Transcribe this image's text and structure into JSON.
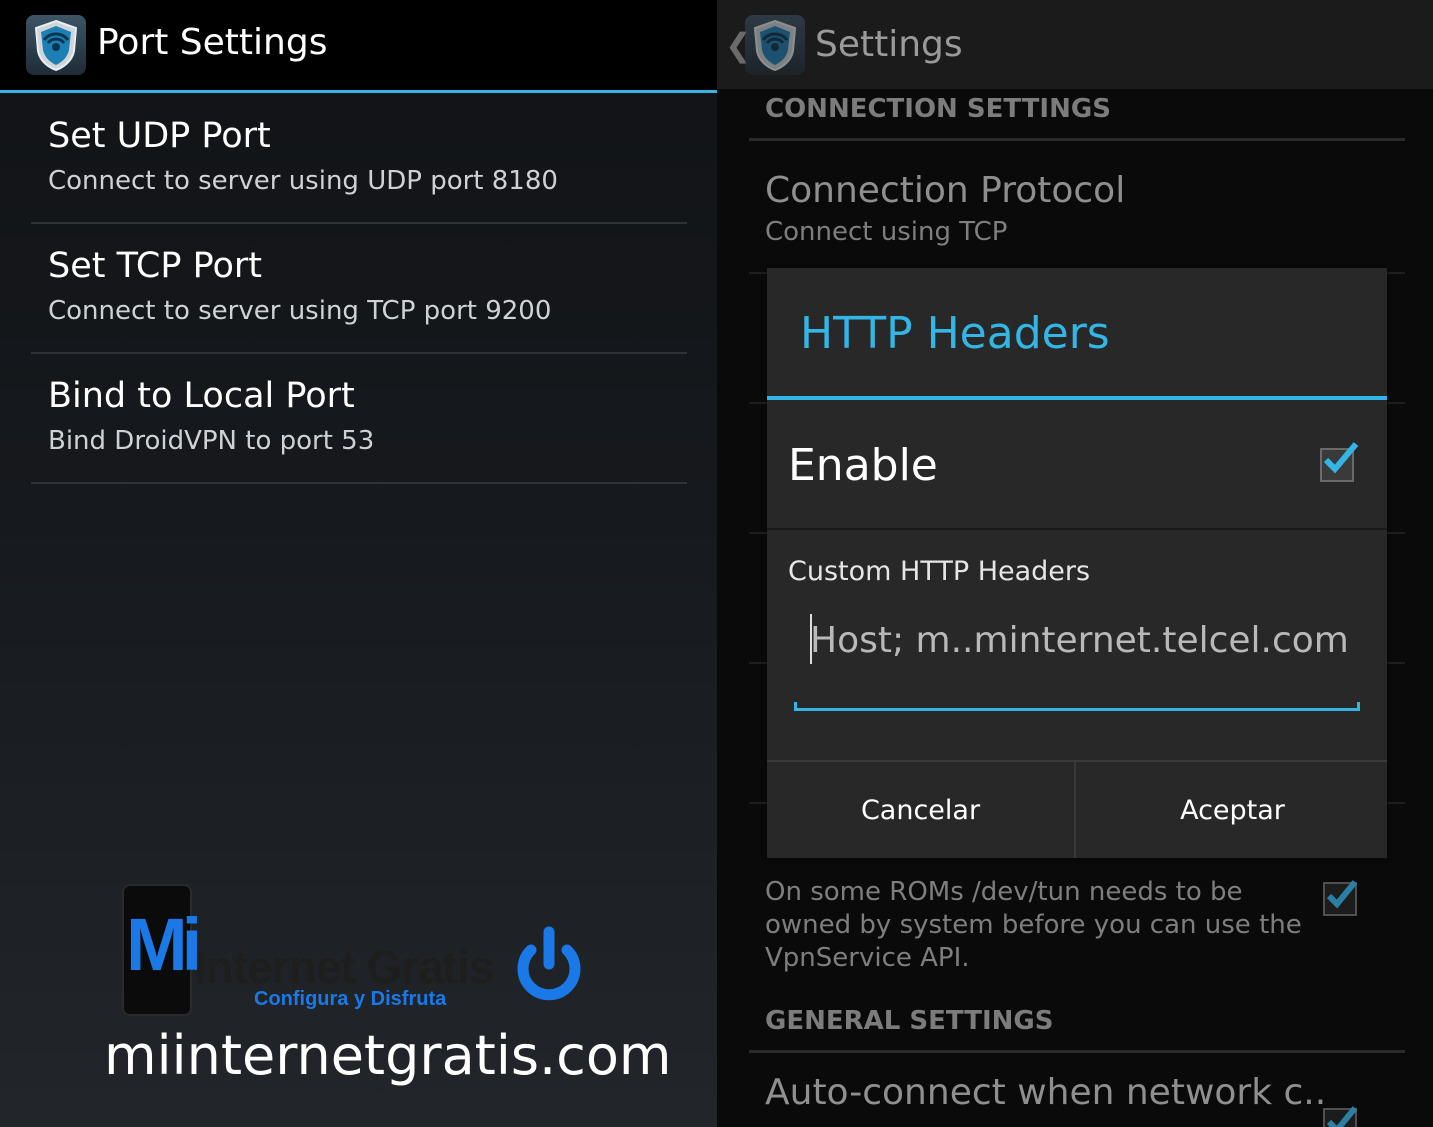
{
  "left": {
    "title": "Port Settings",
    "items": [
      {
        "title": "Set UDP Port",
        "summary": "Connect to server using UDP port 8180"
      },
      {
        "title": "Set TCP Port",
        "summary": "Connect to server using TCP port 9200"
      },
      {
        "title": "Bind to Local Port",
        "summary": "Bind DroidVPN to port 53"
      }
    ],
    "watermark": {
      "mi": "Mi",
      "name": "Internet Gratis",
      "tagline": "Configura y Disfruta",
      "domain": "miinternetgratis.com"
    }
  },
  "right": {
    "title": "Settings",
    "section_connection": "CONNECTION SETTINGS",
    "protocol": {
      "title": "Connection Protocol",
      "summary": "Connect using TCP"
    },
    "tun_summary": "On some ROMs /dev/tun needs to be owned by system before you can use the VpnService API.",
    "section_general": "GENERAL SETTINGS",
    "autoconnect_title": "Auto-connect when network c.."
  },
  "dialog": {
    "title": "HTTP Headers",
    "enable_label": "Enable",
    "enable_checked": true,
    "custom_label": "Custom HTTP Headers",
    "custom_value": "Host; m..minternet.telcel.com",
    "cancel_label": "Cancelar",
    "ok_label": "Aceptar"
  },
  "colors": {
    "accent": "#33b5e5",
    "brand_blue": "#1a79e6"
  },
  "icons": {
    "app": "droidvpn-shield-icon",
    "back": "chevron-left-icon",
    "check": "checkmark-icon",
    "power": "power-icon"
  }
}
